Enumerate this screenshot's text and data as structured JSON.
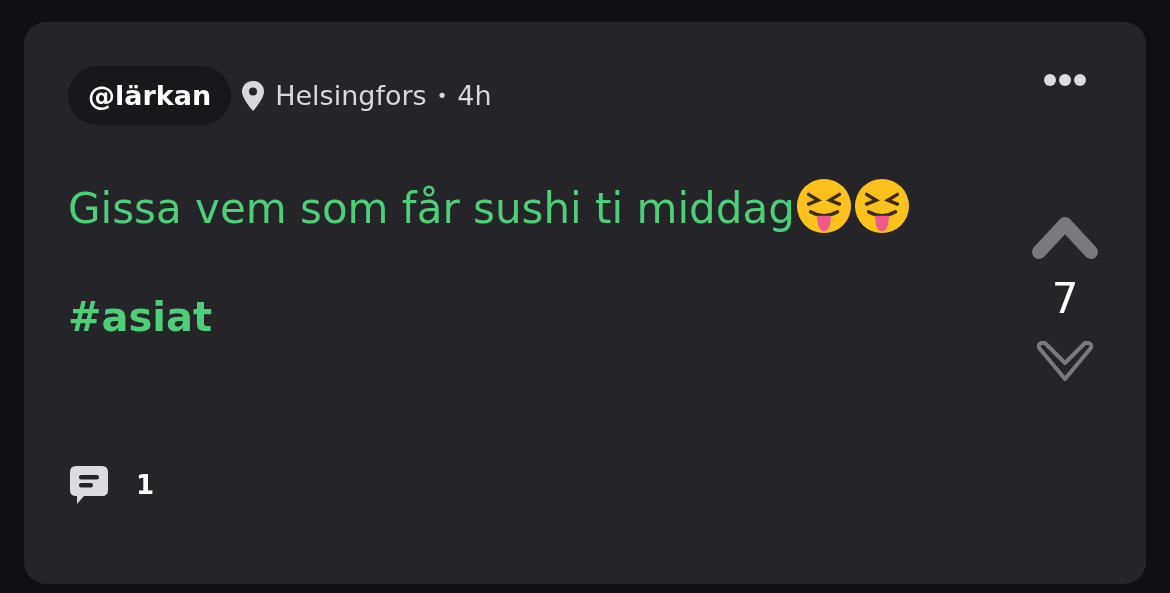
{
  "post": {
    "username": "@lärkan",
    "location": "Helsingfors",
    "separator": "•",
    "age": "4h",
    "body": [
      {
        "kind": "text",
        "text": "Gissa vem som får sushi ti middag"
      },
      {
        "kind": "emoji"
      },
      {
        "kind": "emoji"
      }
    ],
    "hashtag": "#asiat",
    "comments": "1",
    "score": "7",
    "upvoted": true,
    "downvoted": false
  }
}
